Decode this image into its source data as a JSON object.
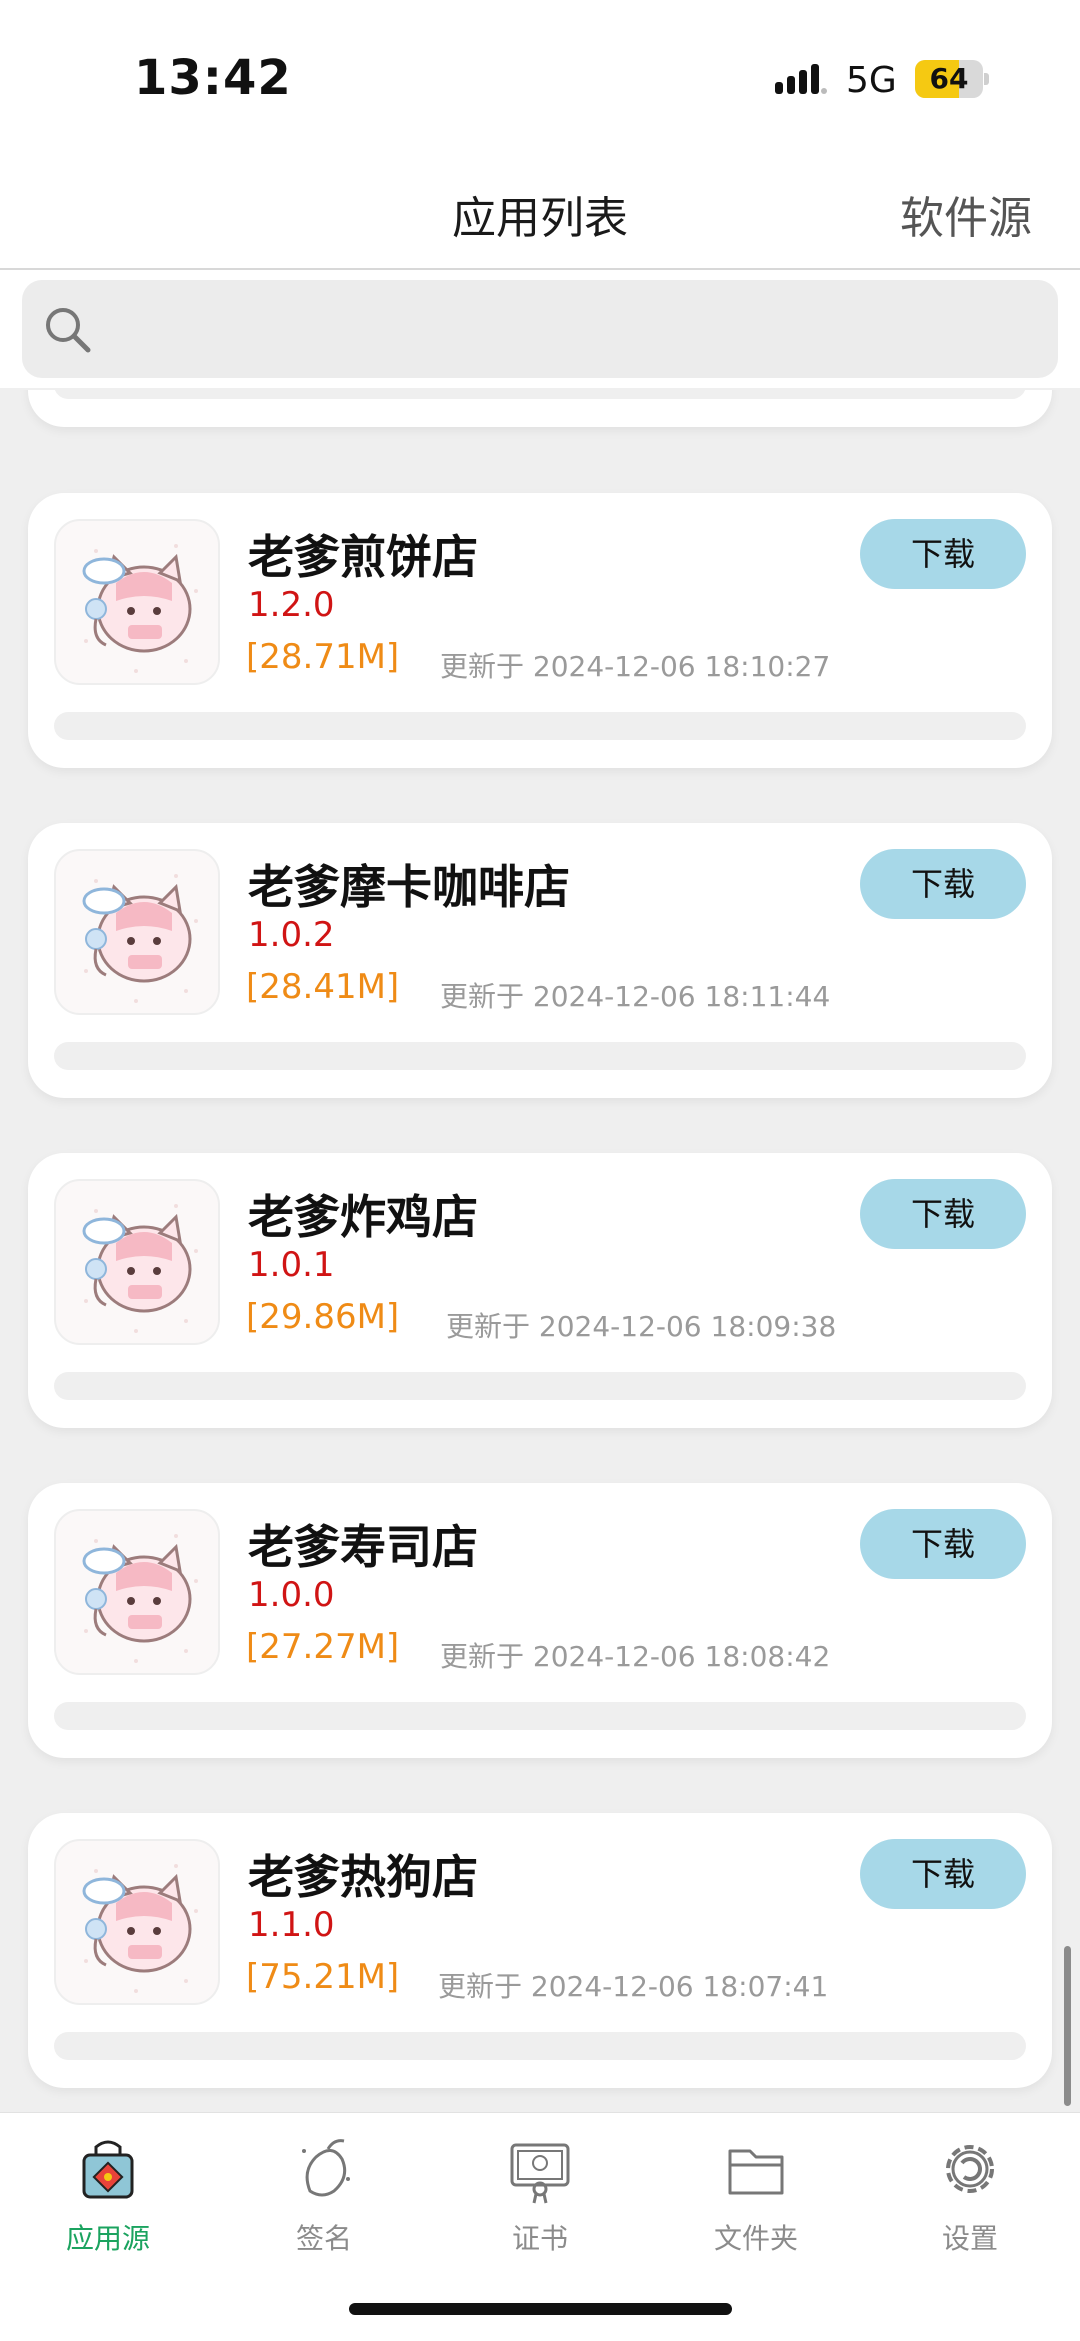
{
  "status_bar": {
    "time": "13:42",
    "network": "5G",
    "battery_level": "64",
    "battery_fraction": 0.64
  },
  "nav": {
    "title": "应用列表",
    "right_action": "软件源"
  },
  "search": {
    "placeholder": ""
  },
  "apps": [
    {
      "name": "老爹煎饼店",
      "version": "1.2.0",
      "size": "[28.71M]",
      "updated": "更新于 2024-12-06 18:10:27",
      "download_label": "下载"
    },
    {
      "name": "老爹摩卡咖啡店",
      "version": "1.0.2",
      "size": "[28.41M]",
      "updated": "更新于 2024-12-06 18:11:44",
      "download_label": "下载"
    },
    {
      "name": "老爹炸鸡店",
      "version": "1.0.1",
      "size": "[29.86M]",
      "updated": "更新于 2024-12-06 18:09:38",
      "download_label": "下载"
    },
    {
      "name": "老爹寿司店",
      "version": "1.0.0",
      "size": "[27.27M]",
      "updated": "更新于 2024-12-06 18:08:42",
      "download_label": "下载"
    },
    {
      "name": "老爹热狗店",
      "version": "1.1.0",
      "size": "[75.21M]",
      "updated": "更新于 2024-12-06 18:07:41",
      "download_label": "下载"
    }
  ],
  "tabs": [
    {
      "label": "应用源",
      "icon": "app-source-bag-icon",
      "active": true
    },
    {
      "label": "签名",
      "icon": "mango-icon",
      "active": false
    },
    {
      "label": "证书",
      "icon": "certificate-icon",
      "active": false
    },
    {
      "label": "文件夹",
      "icon": "folder-icon",
      "active": false
    },
    {
      "label": "设置",
      "icon": "gear-icon",
      "active": false
    }
  ],
  "colors": {
    "accent": "#1ba35f",
    "version": "#d01414",
    "size": "#ef8b16",
    "download_button": "#a7d8e8"
  }
}
